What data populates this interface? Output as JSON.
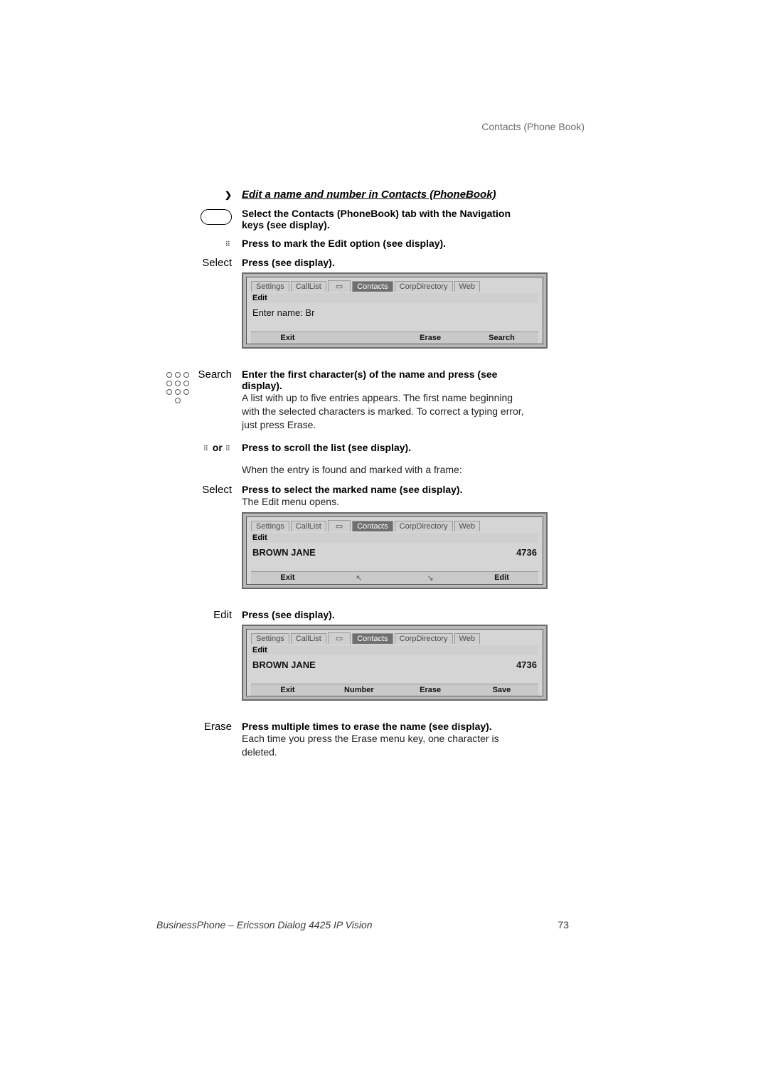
{
  "header": {
    "doc_section": "Contacts (Phone Book)"
  },
  "footer": {
    "product": "BusinessPhone – Ericsson Dialog 4425 IP Vision",
    "page": "73"
  },
  "section_title": "Edit a name and number in Contacts (PhoneBook)",
  "steps": {
    "s1": {
      "icon_label": "❯",
      "bold": "Select the Contacts (PhoneBook) tab with the Navigation keys (see display)."
    },
    "s2": {
      "bold": "Press to mark the Edit option (see display)."
    },
    "s3": {
      "label": "Select",
      "bold": "Press (see display)."
    },
    "s4": {
      "label": "Search",
      "bold": "Enter the first character(s) of the name and press (see display).",
      "body": "A list with up to five entries appears. The first name beginning with the selected characters is marked. To correct a typing error, just press Erase."
    },
    "s5": {
      "label_or": "or",
      "bold": "Press to scroll the list (see display)."
    },
    "s6": {
      "body": "When the entry is found and marked with a frame:"
    },
    "s7": {
      "label": "Select",
      "bold": "Press to select the marked name (see display).",
      "body": "The Edit menu opens."
    },
    "s8": {
      "label": "Edit",
      "bold": "Press (see display)."
    },
    "s9": {
      "label": "Erase",
      "bold": "Press multiple times to erase the name (see display).",
      "body": "Each time you press the Erase menu key, one character is deleted."
    }
  },
  "display_common": {
    "tabs": {
      "settings": "Settings",
      "calllist": "CallList",
      "contacts": "Contacts",
      "corpdir": "CorpDirectory",
      "web": "Web"
    },
    "subhead": "Edit"
  },
  "display1": {
    "prompt": "Enter name: Br",
    "softkeys": {
      "k1": "Exit",
      "k2": "",
      "k3": "Erase",
      "k4": "Search"
    }
  },
  "display2": {
    "name": "BROWN JANE",
    "number": "4736",
    "softkeys": {
      "k1": "Exit",
      "k2": "↖",
      "k3": "↘",
      "k4": "Edit"
    }
  },
  "display3": {
    "name": "BROWN JANE",
    "number": "4736",
    "softkeys": {
      "k1": "Exit",
      "k2": "Number",
      "k3": "Erase",
      "k4": "Save"
    }
  }
}
